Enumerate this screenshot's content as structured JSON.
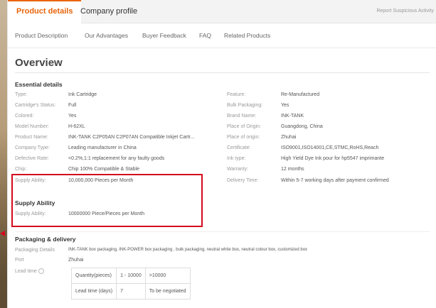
{
  "tabs": {
    "product": "Product details",
    "company": "Company profile"
  },
  "report": "Report Suspicious Activity",
  "subnav": [
    "Product Description",
    "Our Advantages",
    "Buyer Feedback",
    "FAQ",
    "Related Products"
  ],
  "overview": "Overview",
  "essential": {
    "title": "Essential details",
    "left": [
      {
        "label": "Type:",
        "value": "Ink Cartridge"
      },
      {
        "label": "Cartridge's Status:",
        "value": "Full"
      },
      {
        "label": "Colored:",
        "value": "Yes"
      },
      {
        "label": "Model Number:",
        "value": "H-62XL"
      },
      {
        "label": "Product Name:",
        "value": "INK-TANK C2P05AN C2P07AN Compatible Inkjet Cartr..."
      },
      {
        "label": "Company Type:",
        "value": "Leading manufacturer in China"
      },
      {
        "label": "Defective Rate:",
        "value": "<0.2%,1:1 replacement for any faulty goods"
      },
      {
        "label": "Chip:",
        "value": "Chip 100% Compatible & Stable"
      },
      {
        "label": "Supply Ability:",
        "value": "10,000,000 Pieces per Month"
      }
    ],
    "right": [
      {
        "label": "Feature:",
        "value": "Re-Manufactured"
      },
      {
        "label": "Bulk Packaging:",
        "value": "Yes"
      },
      {
        "label": "Brand Name:",
        "value": "INK-TANK"
      },
      {
        "label": "Place of Origin:",
        "value": "Guangdong, China"
      },
      {
        "label": "Place of origin:",
        "value": "Zhuhai"
      },
      {
        "label": "Certificate:",
        "value": "ISO9001,ISO14001,CE,STMC,RoHS,Reach"
      },
      {
        "label": "Ink type:",
        "value": "High Yield Dye Ink pour for hp5547 imprimante"
      },
      {
        "label": "Warranty:",
        "value": "12 months"
      },
      {
        "label": "Delivery Time:",
        "value": "Within 5-7 working days after payment confirmed"
      }
    ]
  },
  "supply": {
    "title": "Supply Ability",
    "label": "Supply Ability:",
    "value": "10000000 Piece/Pieces per Month"
  },
  "packaging": {
    "title": "Packaging & delivery",
    "details_label": "Packaging Details",
    "details_value": "INK-TANK box packaging, INK-POWER box packaging , bulk packaging, neutral white box, neutral colour box, customized box",
    "port_label": "Port",
    "port_value": "Zhuhai",
    "lead_label": "Lead time",
    "lead_table": [
      [
        "Quantity(pieces)",
        "1 - 10000",
        ">10000"
      ],
      [
        "Lead time (days)",
        "7",
        "To be negotiated"
      ]
    ]
  },
  "colors": {
    "accent": "#e8650c",
    "highlight": "#d40a1c"
  }
}
